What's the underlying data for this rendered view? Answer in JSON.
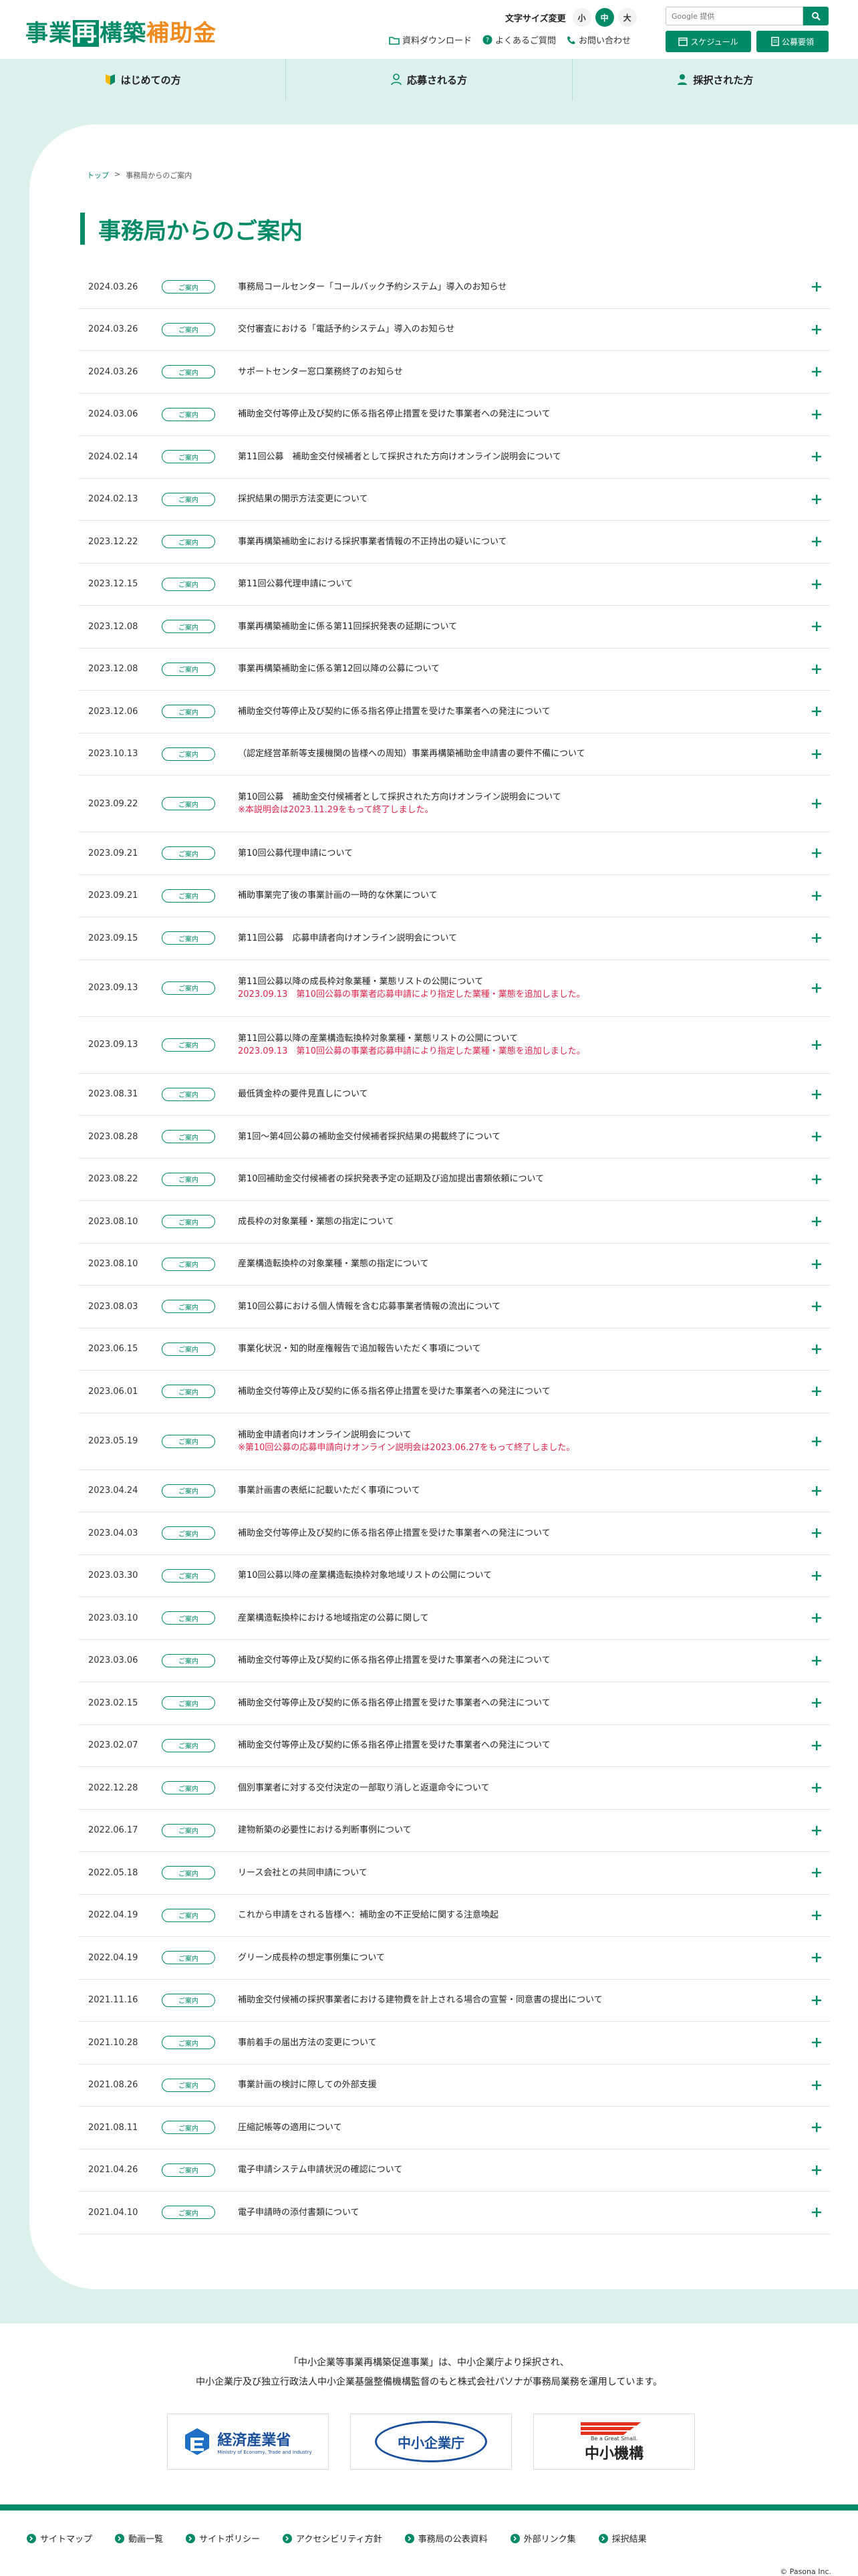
{
  "header": {
    "logo": {
      "part1": "事業",
      "part2": "再",
      "part3": "構築",
      "part4": "補助金"
    },
    "font_size": {
      "label": "文字サイズ変更",
      "options": [
        "小",
        "中",
        "大"
      ],
      "selected": "中"
    },
    "search": {
      "placeholder": "Google 提供"
    },
    "links": [
      "資料ダウンロード",
      "よくあるご質問",
      "お問い合わせ"
    ],
    "buttons": [
      "スケジュール",
      "公募要領"
    ]
  },
  "nav": {
    "items": [
      "はじめての方",
      "応募される方",
      "採択された方"
    ]
  },
  "breadcrumb": {
    "home": "トップ",
    "sep": ">",
    "current": "事務局からのご案内"
  },
  "page": {
    "title": "事務局からのご案内"
  },
  "news": [
    {
      "date": "2024.03.26",
      "badge": "ご案内",
      "title": "事務局コールセンター「コールバック予約システム」導入のお知らせ",
      "note": ""
    },
    {
      "date": "2024.03.26",
      "badge": "ご案内",
      "title": "交付審査における「電話予約システム」導入のお知らせ",
      "note": ""
    },
    {
      "date": "2024.03.26",
      "badge": "ご案内",
      "title": "サポートセンター窓口業務終了のお知らせ",
      "note": ""
    },
    {
      "date": "2024.03.06",
      "badge": "ご案内",
      "title": "補助金交付等停止及び契約に係る指名停止措置を受けた事業者への発注について",
      "note": ""
    },
    {
      "date": "2024.02.14",
      "badge": "ご案内",
      "title": "第11回公募　補助金交付候補者として採択された方向けオンライン説明会について",
      "note": ""
    },
    {
      "date": "2024.02.13",
      "badge": "ご案内",
      "title": "採択結果の開示方法変更について",
      "note": ""
    },
    {
      "date": "2023.12.22",
      "badge": "ご案内",
      "title": "事業再構築補助金における採択事業者情報の不正持出の疑いについて",
      "note": ""
    },
    {
      "date": "2023.12.15",
      "badge": "ご案内",
      "title": "第11回公募代理申請について",
      "note": ""
    },
    {
      "date": "2023.12.08",
      "badge": "ご案内",
      "title": "事業再構築補助金に係る第11回採択発表の延期について",
      "note": ""
    },
    {
      "date": "2023.12.08",
      "badge": "ご案内",
      "title": "事業再構築補助金に係る第12回以降の公募について",
      "note": ""
    },
    {
      "date": "2023.12.06",
      "badge": "ご案内",
      "title": "補助金交付等停止及び契約に係る指名停止措置を受けた事業者への発注について",
      "note": ""
    },
    {
      "date": "2023.10.13",
      "badge": "ご案内",
      "title": "（認定経営革新等支援機関の皆様への周知）事業再構築補助金申請書の要件不備について",
      "note": ""
    },
    {
      "date": "2023.09.22",
      "badge": "ご案内",
      "title": "第10回公募　補助金交付候補者として採択された方向けオンライン説明会について",
      "note": "※本説明会は2023.11.29をもって終了しました。"
    },
    {
      "date": "2023.09.21",
      "badge": "ご案内",
      "title": "第10回公募代理申請について",
      "note": ""
    },
    {
      "date": "2023.09.21",
      "badge": "ご案内",
      "title": "補助事業完了後の事業計画の一時的な休業について",
      "note": ""
    },
    {
      "date": "2023.09.15",
      "badge": "ご案内",
      "title": "第11回公募　応募申請者向けオンライン説明会について",
      "note": ""
    },
    {
      "date": "2023.09.13",
      "badge": "ご案内",
      "title": "第11回公募以降の成長枠対象業種・業態リストの公開について",
      "note": "2023.09.13　第10回公募の事業者応募申請により指定した業種・業態を追加しました。"
    },
    {
      "date": "2023.09.13",
      "badge": "ご案内",
      "title": "第11回公募以降の産業構造転換枠対象業種・業態リストの公開について",
      "note": "2023.09.13　第10回公募の事業者応募申請により指定した業種・業態を追加しました。"
    },
    {
      "date": "2023.08.31",
      "badge": "ご案内",
      "title": "最低賃金枠の要件見直しについて",
      "note": ""
    },
    {
      "date": "2023.08.28",
      "badge": "ご案内",
      "title": "第1回～第4回公募の補助金交付候補者採択結果の掲載終了について",
      "note": ""
    },
    {
      "date": "2023.08.22",
      "badge": "ご案内",
      "title": "第10回補助金交付候補者の採択発表予定の延期及び追加提出書類依頼について",
      "note": ""
    },
    {
      "date": "2023.08.10",
      "badge": "ご案内",
      "title": "成長枠の対象業種・業態の指定について",
      "note": ""
    },
    {
      "date": "2023.08.10",
      "badge": "ご案内",
      "title": "産業構造転換枠の対象業種・業態の指定について",
      "note": ""
    },
    {
      "date": "2023.08.03",
      "badge": "ご案内",
      "title": "第10回公募における個人情報を含む応募事業者情報の流出について",
      "note": ""
    },
    {
      "date": "2023.06.15",
      "badge": "ご案内",
      "title": "事業化状況・知的財産権報告で追加報告いただく事項について",
      "note": ""
    },
    {
      "date": "2023.06.01",
      "badge": "ご案内",
      "title": "補助金交付等停止及び契約に係る指名停止措置を受けた事業者への発注について",
      "note": ""
    },
    {
      "date": "2023.05.19",
      "badge": "ご案内",
      "title": "補助金申請者向けオンライン説明会について",
      "note": "※第10回公募の応募申請向けオンライン説明会は2023.06.27をもって終了しました。"
    },
    {
      "date": "2023.04.24",
      "badge": "ご案内",
      "title": "事業計画書の表紙に記載いただく事項について",
      "note": ""
    },
    {
      "date": "2023.04.03",
      "badge": "ご案内",
      "title": "補助金交付等停止及び契約に係る指名停止措置を受けた事業者への発注について",
      "note": ""
    },
    {
      "date": "2023.03.30",
      "badge": "ご案内",
      "title": "第10回公募以降の産業構造転換枠対象地域リストの公開について",
      "note": ""
    },
    {
      "date": "2023.03.10",
      "badge": "ご案内",
      "title": "産業構造転換枠における地域指定の公募に関して",
      "note": ""
    },
    {
      "date": "2023.03.06",
      "badge": "ご案内",
      "title": "補助金交付等停止及び契約に係る指名停止措置を受けた事業者への発注について",
      "note": ""
    },
    {
      "date": "2023.02.15",
      "badge": "ご案内",
      "title": "補助金交付等停止及び契約に係る指名停止措置を受けた事業者への発注について",
      "note": ""
    },
    {
      "date": "2023.02.07",
      "badge": "ご案内",
      "title": "補助金交付等停止及び契約に係る指名停止措置を受けた事業者への発注について",
      "note": ""
    },
    {
      "date": "2022.12.28",
      "badge": "ご案内",
      "title": "個別事業者に対する交付決定の一部取り消しと返還命令について",
      "note": ""
    },
    {
      "date": "2022.06.17",
      "badge": "ご案内",
      "title": "建物新築の必要性における判断事例について",
      "note": ""
    },
    {
      "date": "2022.05.18",
      "badge": "ご案内",
      "title": "リース会社との共同申請について",
      "note": ""
    },
    {
      "date": "2022.04.19",
      "badge": "ご案内",
      "title": "これから申請をされる皆様へ：補助金の不正受給に関する注意喚起",
      "note": ""
    },
    {
      "date": "2022.04.19",
      "badge": "ご案内",
      "title": "グリーン成長枠の想定事例集について",
      "note": ""
    },
    {
      "date": "2021.11.16",
      "badge": "ご案内",
      "title": "補助金交付候補の採択事業者における建物費を計上される場合の宣誓・同意書の提出について",
      "note": ""
    },
    {
      "date": "2021.10.28",
      "badge": "ご案内",
      "title": "事前着手の届出方法の変更について",
      "note": ""
    },
    {
      "date": "2021.08.26",
      "badge": "ご案内",
      "title": "事業計画の検討に際しての外部支援",
      "note": ""
    },
    {
      "date": "2021.08.11",
      "badge": "ご案内",
      "title": "圧縮記帳等の適用について",
      "note": ""
    },
    {
      "date": "2021.04.26",
      "badge": "ご案内",
      "title": "電子申請システム申請状況の確認について",
      "note": ""
    },
    {
      "date": "2021.04.10",
      "badge": "ご案内",
      "title": "電子申請時の添付書類について",
      "note": ""
    }
  ],
  "footer": {
    "info_line1": "「中小企業等事業再構築促進事業」は、中小企業庁より採択され、",
    "info_line2": "中小企業庁及び独立行政法人中小企業基盤整備機構監督のもと株式会社パソナが事務局業務を運用しています。",
    "logos": [
      {
        "name": "経済産業省",
        "sub": "Ministry of Economy, Trade and Industry"
      },
      {
        "name": "中小企業庁",
        "sub": ""
      },
      {
        "name": "中小機構",
        "sub": "Be a Great Small."
      }
    ],
    "links": [
      "サイトマップ",
      "動画一覧",
      "サイトポリシー",
      "アクセシビリティ方針",
      "事務局の公表資料",
      "外部リンク集",
      "採択結果"
    ],
    "copyright": "© Pasona Inc."
  },
  "colors": {
    "accent": "#008a67",
    "accent_light": "#ddf1ec",
    "orange": "#ef8a1e",
    "alert": "#e2244b"
  }
}
